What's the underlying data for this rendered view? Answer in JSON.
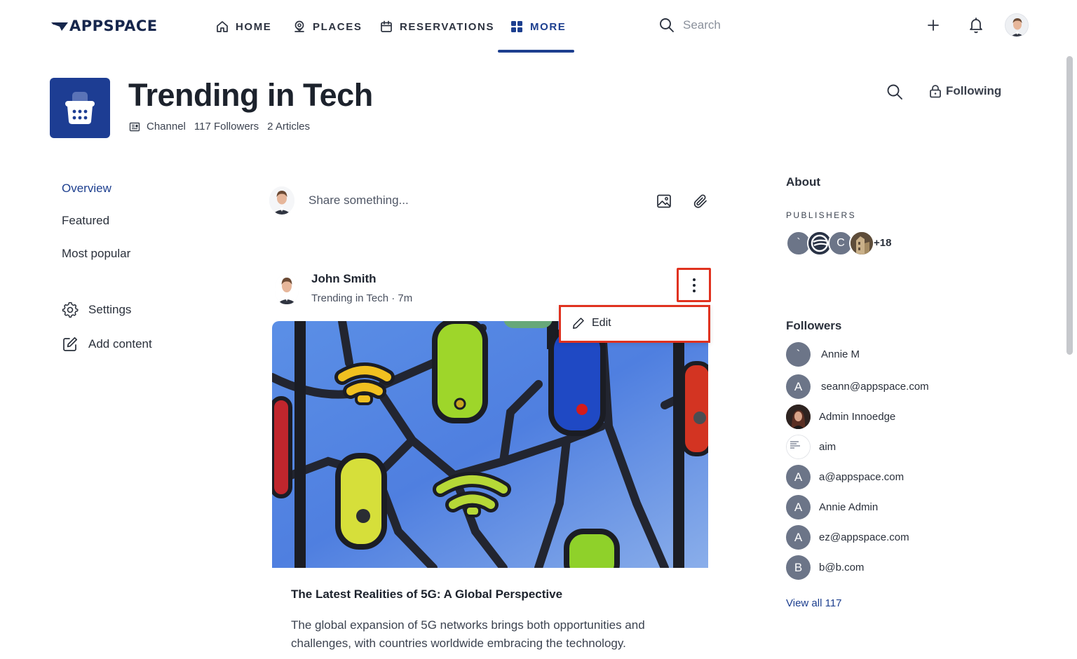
{
  "brand": {
    "name": "APPSPACE",
    "color": "#16264c"
  },
  "nav": {
    "items": [
      {
        "label": "HOME",
        "icon": "home-icon"
      },
      {
        "label": "PLACES",
        "icon": "places-pin-icon"
      },
      {
        "label": "RESERVATIONS",
        "icon": "calendar-icon"
      },
      {
        "label": "MORE",
        "icon": "grid-icon",
        "active": true
      }
    ],
    "search_placeholder": "Search",
    "accent": "#1d3f8f"
  },
  "channel": {
    "title": "Trending in Tech",
    "type": "Channel",
    "followers": "117 Followers",
    "articles": "2 Articles",
    "following_label": "Following"
  },
  "sidebar": {
    "links": [
      {
        "label": "Overview",
        "active": true
      },
      {
        "label": "Featured"
      },
      {
        "label": "Most popular"
      }
    ],
    "actions": [
      {
        "label": "Settings",
        "icon": "gear-icon"
      },
      {
        "label": "Add content",
        "icon": "edit-square-icon"
      }
    ]
  },
  "composer": {
    "placeholder": "Share something..."
  },
  "post": {
    "author": "John Smith",
    "subtitle": "Trending in Tech · 7m",
    "menu": {
      "edit_label": "Edit"
    },
    "article_title": "The Latest Realities of 5G: A Global Perspective",
    "article_desc": "The global expansion of 5G networks brings both opportunities and challenges, with countries worldwide embracing the technology."
  },
  "about": {
    "title": "About",
    "publishers_label": "PUBLISHERS",
    "publishers": [
      {
        "initial": "`",
        "color": "#6c7588"
      },
      {
        "initial": "",
        "color": "#2a3346"
      },
      {
        "initial": "C",
        "color": "#6c7588"
      },
      {
        "initial": "",
        "color": "#7a6a52"
      }
    ],
    "more": "+18"
  },
  "followers": {
    "title": "Followers",
    "list": [
      {
        "initial": "`",
        "name": "Annie M"
      },
      {
        "initial": "A",
        "name": "seann@appspace.com"
      },
      {
        "initial": "",
        "name": "Admin Innoedge",
        "photo": true
      },
      {
        "initial": "",
        "name": "aim",
        "doc": true
      },
      {
        "initial": "A",
        "name": "a@appspace.com"
      },
      {
        "initial": "A",
        "name": "Annie Admin"
      },
      {
        "initial": "A",
        "name": "ez@appspace.com"
      },
      {
        "initial": "B",
        "name": "b@b.com"
      }
    ],
    "view_all": "View all 117"
  },
  "colors": {
    "highlight": "#e0321f",
    "avatar_gray": "#6c7588"
  }
}
